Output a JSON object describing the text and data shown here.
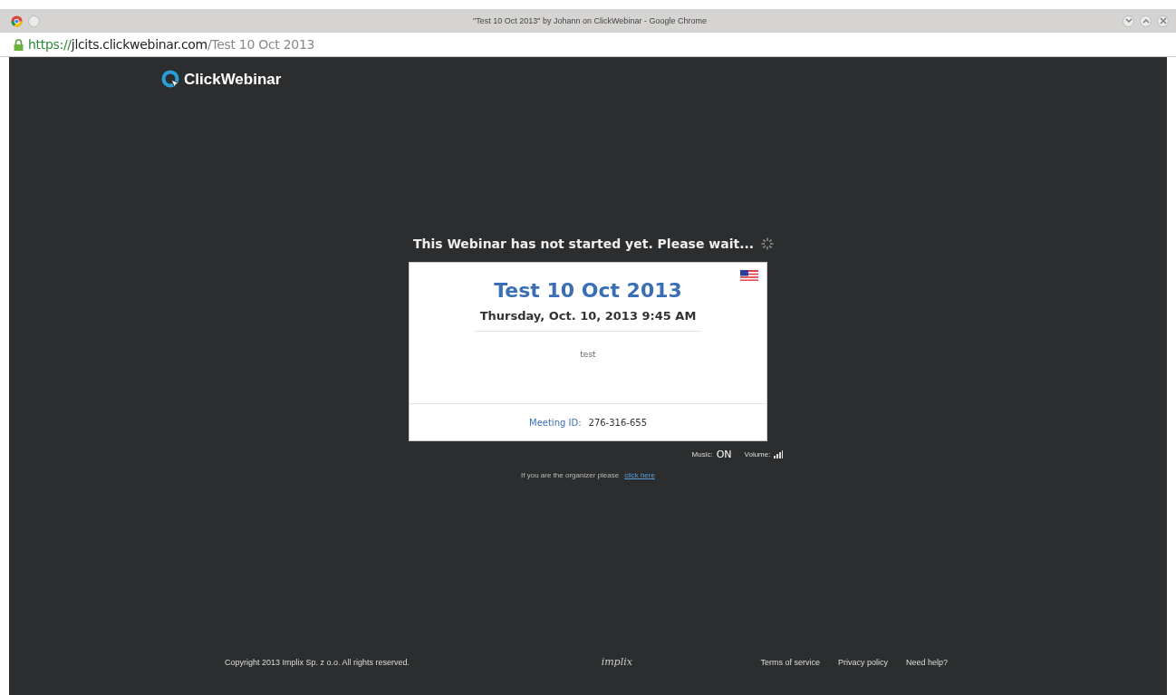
{
  "window": {
    "title": "\"Test 10 Oct 2013\" by Johann on ClickWebinar - Google Chrome"
  },
  "address_bar": {
    "scheme": "https://",
    "host": "jlcits.clickwebinar.com",
    "path": "/Test 10 Oct 2013"
  },
  "logo": {
    "text": "ClickWebinar"
  },
  "status_message": "This Webinar has not started yet. Please wait...",
  "card": {
    "title": "Test 10 Oct 2013",
    "datetime": "Thursday, Oct. 10, 2013 9:45 AM",
    "description": "test",
    "meeting_id_label": "Meeting ID:",
    "meeting_id": "276-316-655"
  },
  "audio": {
    "music_label": "Music:",
    "music_value": "ON",
    "volume_label": "Volume:"
  },
  "organizer": {
    "text": "If you are the organizer please",
    "link": "click here"
  },
  "footer": {
    "copyright": "Copyright  2013 Implix Sp. z o.o. All rights reserved.",
    "brand": "implix",
    "links": [
      "Terms of service",
      "Privacy policy",
      "Need help?"
    ]
  }
}
